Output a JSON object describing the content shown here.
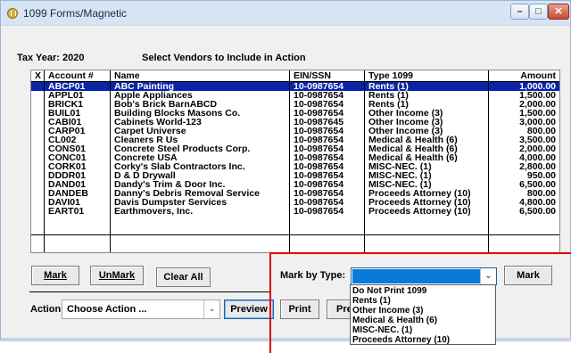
{
  "window": {
    "title": "1099 Forms/Magnetic",
    "controls": {
      "minimize": "–",
      "maximize": "□",
      "close": "✕"
    }
  },
  "header": {
    "tax_year": "Tax Year: 2020",
    "instruction": "Select Vendors to Include in Action"
  },
  "table": {
    "columns": {
      "x": "X",
      "account": "Account #",
      "name": "Name",
      "ein": "EIN/SSN",
      "type": "Type 1099",
      "amount": "Amount"
    },
    "rows": [
      {
        "account": "ABCP01",
        "name": "ABC Painting",
        "ein": "10-0987654",
        "type": "Rents (1)",
        "amount": "1,000.00",
        "selected": true
      },
      {
        "account": "APPL01",
        "name": "Apple Appliances",
        "ein": "10-0987654",
        "type": "Rents (1)",
        "amount": "1,500.00"
      },
      {
        "account": "BRICK1",
        "name": "Bob's Brick BarnABCD",
        "ein": "10-0987654",
        "type": "Rents (1)",
        "amount": "2,000.00"
      },
      {
        "account": "BUIL01",
        "name": "Building Blocks Masons Co.",
        "ein": "10-0987654",
        "type": "Other Income (3)",
        "amount": "1,500.00"
      },
      {
        "account": "CABI01",
        "name": "Cabinets World-123",
        "ein": "10-0987645",
        "type": "Other Income (3)",
        "amount": "3,000.00"
      },
      {
        "account": "CARP01",
        "name": "Carpet Universe",
        "ein": "10-0987654",
        "type": "Other Income (3)",
        "amount": "800.00"
      },
      {
        "account": "CL002",
        "name": "Cleaners R Us",
        "ein": "10-0987654",
        "type": "Medical & Health (6)",
        "amount": "3,500.00"
      },
      {
        "account": "CONS01",
        "name": "Concrete Steel Products Corp.",
        "ein": "10-0987654",
        "type": "Medical & Health (6)",
        "amount": "2,000.00"
      },
      {
        "account": "CONC01",
        "name": "Concrete USA",
        "ein": "10-0987654",
        "type": "Medical & Health (6)",
        "amount": "4,000.00"
      },
      {
        "account": "CORK01",
        "name": "Corky's Slab Contractors Inc.",
        "ein": "10-0987654",
        "type": "MISC-NEC. (1)",
        "amount": "2,800.00"
      },
      {
        "account": "DDDR01",
        "name": "D & D Drywall",
        "ein": "10-0987654",
        "type": "MISC-NEC. (1)",
        "amount": "950.00"
      },
      {
        "account": "DAND01",
        "name": "Dandy's Trim & Door Inc.",
        "ein": "10-0987654",
        "type": "MISC-NEC. (1)",
        "amount": "6,500.00"
      },
      {
        "account": "DANDEB",
        "name": "Danny's Debris Removal Service",
        "ein": "10-0987654",
        "type": "Proceeds Attorney (10)",
        "amount": "800.00"
      },
      {
        "account": "DAVI01",
        "name": "Davis Dumpster Services",
        "ein": "10-0987654",
        "type": "Proceeds Attorney (10)",
        "amount": "4,800.00"
      },
      {
        "account": "EART01",
        "name": "Earthmovers, Inc.",
        "ein": "10-0987654",
        "type": "Proceeds Attorney (10)",
        "amount": "6,500.00"
      }
    ]
  },
  "buttons": {
    "mark": "Mark",
    "unmark": "UnMark",
    "clear_all": "Clear All",
    "mark_by_type": "Mark",
    "preview": "Preview",
    "print": "Print",
    "partial": "Pre"
  },
  "mark_by_type": {
    "label": "Mark by Type:",
    "selected_value": "",
    "options": [
      "Do Not Print 1099",
      "Rents (1)",
      "Other Income (3)",
      "Medical & Health (6)",
      "MISC-NEC. (1)",
      "Proceeds Attorney (10)"
    ]
  },
  "action": {
    "label": "Action:",
    "value": "Choose Action ..."
  },
  "colors": {
    "selection": "#0a24a6",
    "highlight_box": "#e00000",
    "dropdown_selected": "#0a7ad8"
  }
}
